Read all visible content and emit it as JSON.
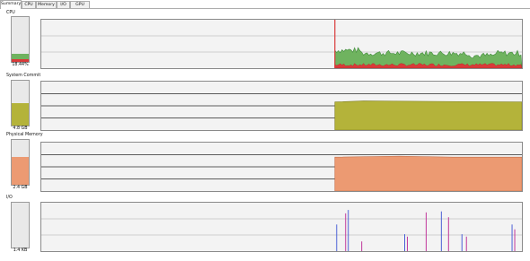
{
  "tabs": [
    {
      "label": "Summary",
      "active": true
    },
    {
      "label": "CPU",
      "active": false
    },
    {
      "label": "Memory",
      "active": false
    },
    {
      "label": "I/O",
      "active": false
    },
    {
      "label": "GPU",
      "active": false
    }
  ],
  "sections": {
    "cpu": {
      "title": "CPU",
      "gauge_value": "18.44%",
      "gauge_fraction": 0.1844,
      "colors": {
        "kernel": "#d93a3a",
        "total": "#6fb35f"
      }
    },
    "commit": {
      "title": "System Commit",
      "gauge_value": "4.8 GB",
      "gauge_fraction": 0.49,
      "colors": {
        "fill": "#b4b33a"
      }
    },
    "physical": {
      "title": "Physical Memory",
      "gauge_value": "2.4 GB",
      "gauge_fraction": 0.62,
      "colors": {
        "fill": "#ec9a72"
      }
    },
    "io": {
      "title": "I/O",
      "gauge_value": "1.4 KB",
      "gauge_fraction": 0.0,
      "colors": {
        "read": "#4a5fd6",
        "write": "#c0369b"
      }
    }
  }
}
